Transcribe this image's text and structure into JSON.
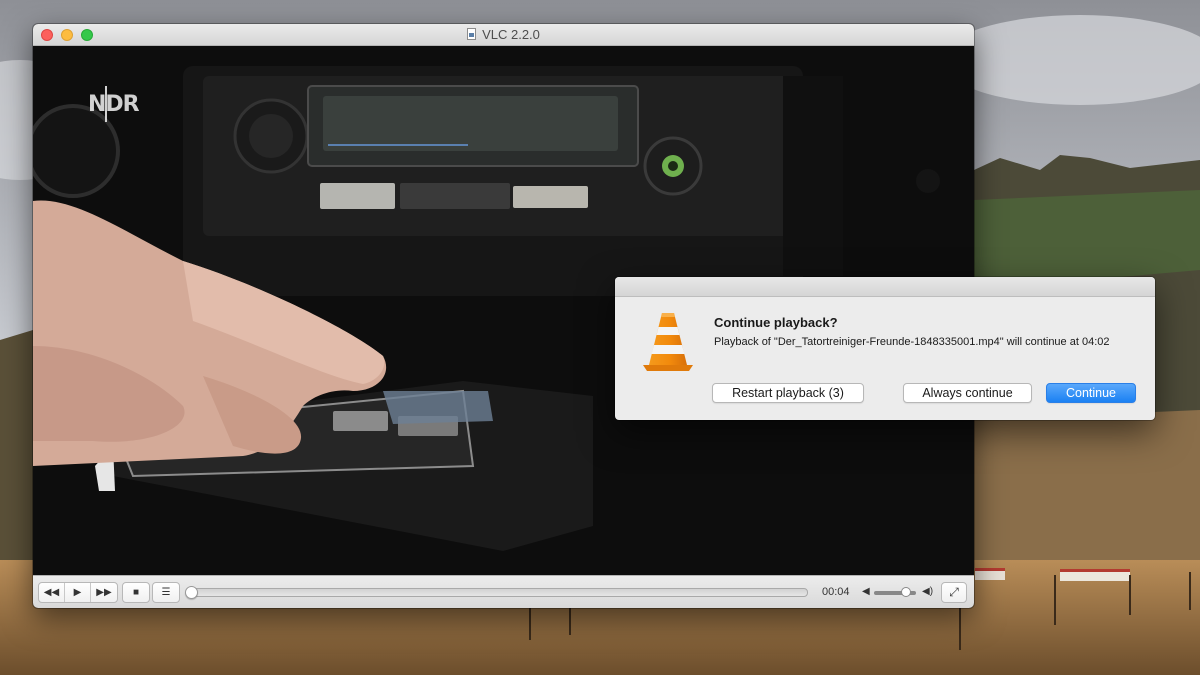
{
  "window": {
    "title": "VLC 2.2.0"
  },
  "video": {
    "channel_logo": "NDR"
  },
  "controls": {
    "rewind_icon": "rewind-icon",
    "play_icon": "play-icon",
    "forward_icon": "fast-forward-icon",
    "stop_icon": "stop-icon",
    "playlist_icon": "playlist-icon",
    "elapsed_time": "00:04",
    "seek_position_fraction": 0.0,
    "volume_fraction": 0.85,
    "fullscreen_icon": "fullscreen-icon"
  },
  "dialog": {
    "icon": "vlc-cone-icon",
    "heading": "Continue playback?",
    "message": "Playback of \"Der_Tatortreiniger-Freunde-1848335001.mp4\" will continue at 04:02",
    "restart_label": "Restart playback (3)",
    "always_label": "Always continue",
    "continue_label": "Continue"
  },
  "colors": {
    "accent": "#1b81f3",
    "vlc_orange": "#f28a0c"
  }
}
